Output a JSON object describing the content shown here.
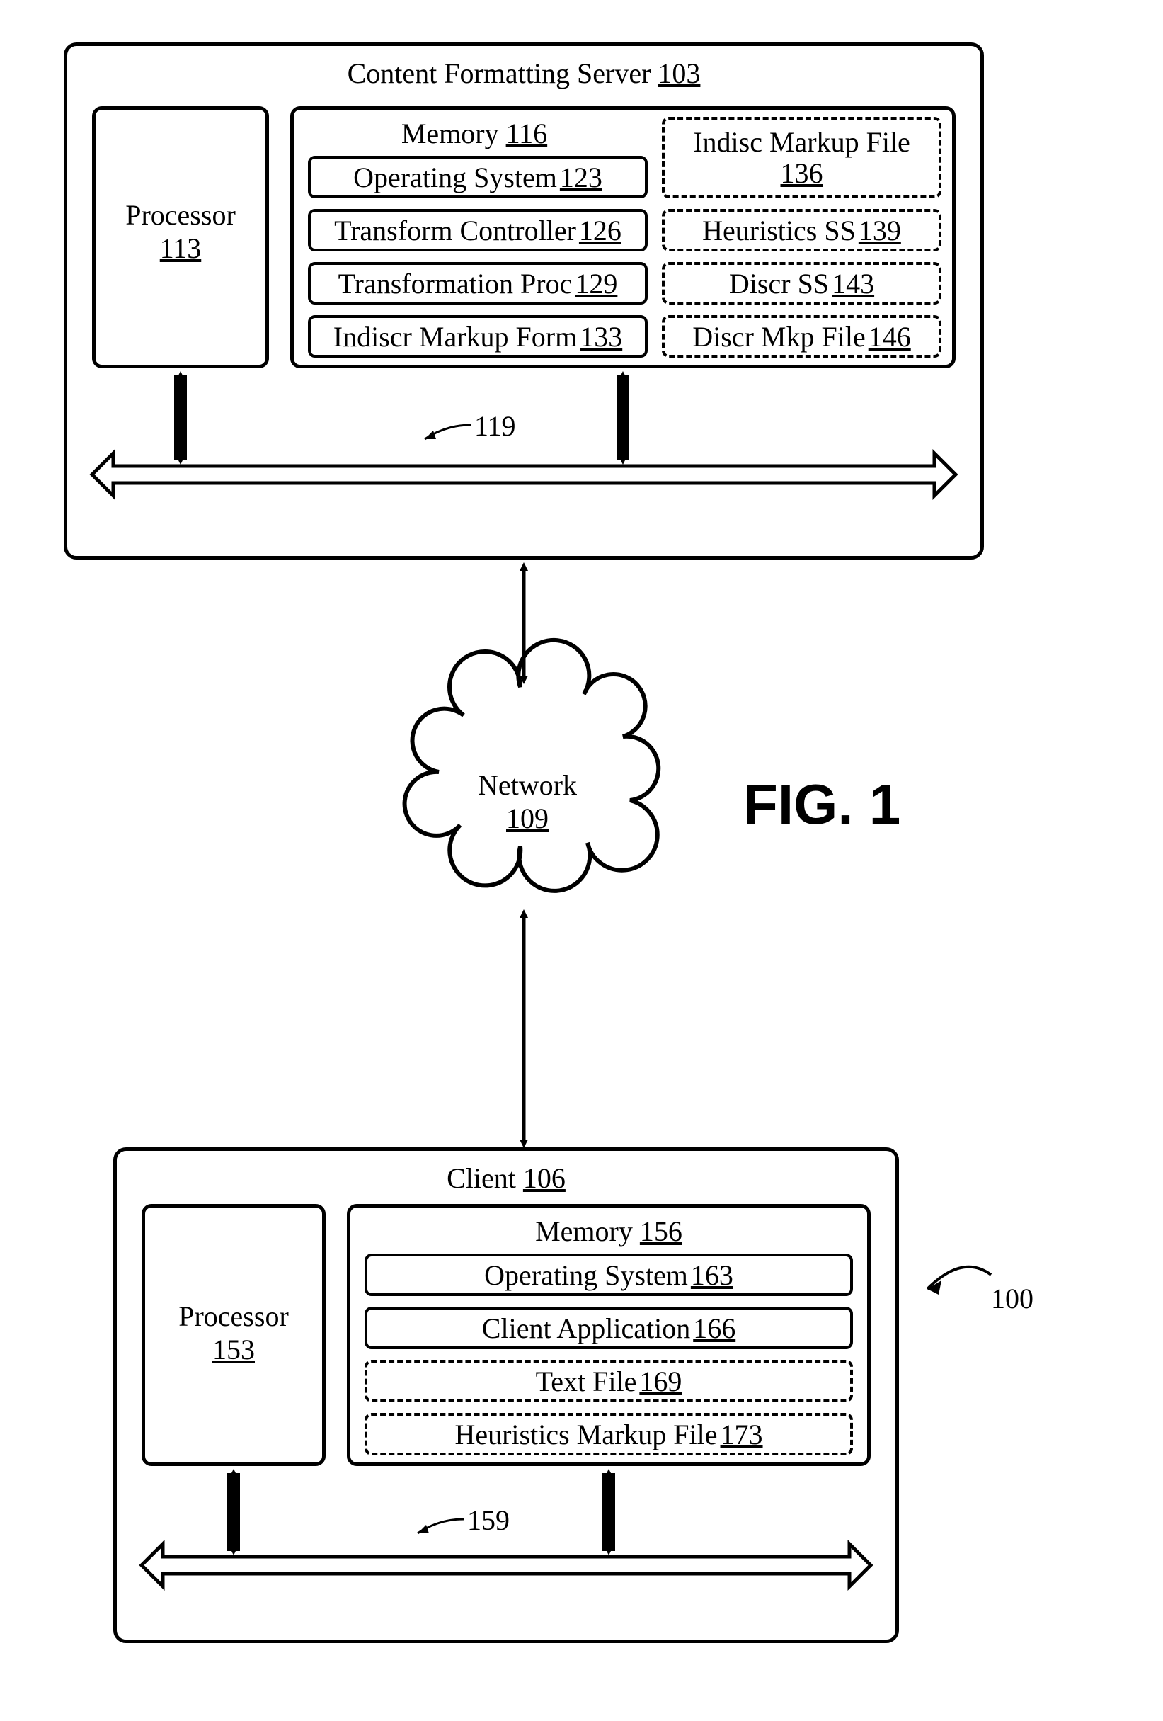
{
  "figure_label": "FIG. 1",
  "system_ref": "100",
  "server": {
    "title": "Content Formatting Server",
    "num": "103",
    "bus_ref": "119",
    "processor": {
      "title": "Processor",
      "num": "113"
    },
    "memory": {
      "title": "Memory",
      "num": "116",
      "left": [
        {
          "title": "Operating System",
          "num": "123"
        },
        {
          "title": "Transform Controller",
          "num": "126"
        },
        {
          "title": "Transformation Proc",
          "num": "129"
        },
        {
          "title": "Indiscr Markup Form",
          "num": "133"
        }
      ],
      "right": [
        {
          "title": "Indisc Markup File",
          "num": "136",
          "tall": true
        },
        {
          "title": "Heuristics SS",
          "num": "139"
        },
        {
          "title": "Discr SS",
          "num": "143"
        },
        {
          "title": "Discr Mkp File",
          "num": "146"
        }
      ]
    }
  },
  "network": {
    "title": "Network",
    "num": "109"
  },
  "client": {
    "title": "Client",
    "num": "106",
    "bus_ref": "159",
    "processor": {
      "title": "Processor",
      "num": "153"
    },
    "memory": {
      "title": "Memory",
      "num": "156",
      "items": [
        {
          "title": "Operating System",
          "num": "163",
          "dashed": false
        },
        {
          "title": "Client Application",
          "num": "166",
          "dashed": false
        },
        {
          "title": "Text File",
          "num": "169",
          "dashed": true
        },
        {
          "title": "Heuristics Markup File",
          "num": "173",
          "dashed": true
        }
      ]
    }
  }
}
